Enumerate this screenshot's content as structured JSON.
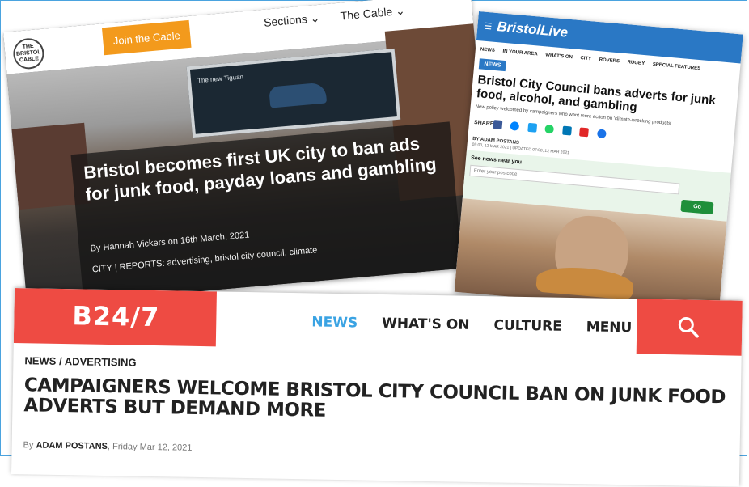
{
  "cable": {
    "logo_text": "THE BRISTOL CABLE",
    "join_label": "Join the Cable",
    "nav": [
      "Sections ⌄",
      "The Cable ⌄"
    ],
    "billboard_text": "The new Tiguan",
    "headline": "Bristol becomes first UK city to ban ads for junk food, payday loans and gambling",
    "byline": "By Hannah Vickers on 16th March, 2021",
    "tags": "CITY | REPORTS: advertising, bristol city council, climate"
  },
  "bristol_live": {
    "logo": "BristolLive",
    "nav": [
      "NEWS",
      "IN YOUR AREA",
      "WHAT'S ON",
      "CITY",
      "ROVERS",
      "RUGBY",
      "SPECIAL FEATURES"
    ],
    "badge": "NEWS",
    "headline": "Bristol City Council bans adverts for junk food, alcohol, and gambling",
    "subtitle": "New policy welcomed by campaigners who want more action on 'climate-wrecking products'",
    "share_label": "SHARE",
    "author": "BY ADAM POSTANS",
    "date": "05:00, 12 MAR 2021   |   UPDATED 07:58, 12 MAR 2021",
    "see_news": "See news near you",
    "postcode_placeholder": "Enter your postcode",
    "go_label": "Go"
  },
  "b247": {
    "logo": "B24/7",
    "nav": {
      "news": "NEWS",
      "whats_on": "WHAT'S ON",
      "culture": "CULTURE",
      "menu": "MENU"
    },
    "breadcrumb": "NEWS / ADVERTISING",
    "headline": "CAMPAIGNERS WELCOME BRISTOL CITY COUNCIL BAN ON JUNK FOOD ADVERTS BUT DEMAND MORE",
    "by_prefix": "By",
    "author": "ADAM POSTANS",
    "date": ", Friday Mar 12, 2021"
  },
  "colors": {
    "cable_orange": "#f39a1c",
    "live_blue": "#2a78c5",
    "b247_red": "#ee4b43",
    "b247_active": "#3aa3e3"
  }
}
